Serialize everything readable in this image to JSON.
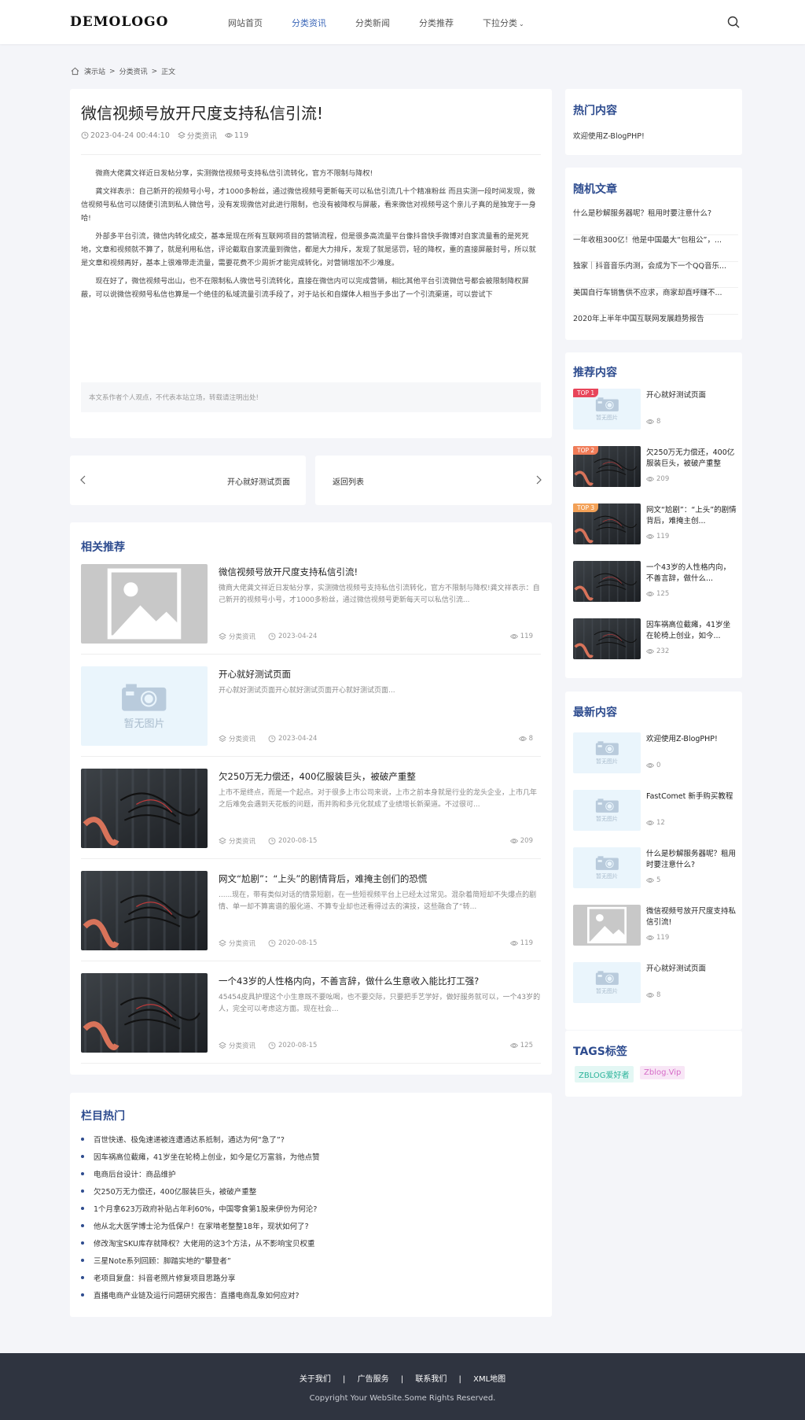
{
  "colors": {
    "accent": "#3a66b8",
    "section_title": "#2e4c8f",
    "footer_bg": "#2f3440",
    "top1": "#e8455a",
    "top2": "#f07c58",
    "top3": "#f3a157"
  },
  "header": {
    "logo": "DEMOLOGO",
    "nav": [
      {
        "label": "网站首页"
      },
      {
        "label": "分类资讯"
      },
      {
        "label": "分类新闻"
      },
      {
        "label": "分类推荐"
      },
      {
        "label": "下拉分类"
      }
    ]
  },
  "breadcrumb": {
    "items": [
      "演示站",
      ">",
      "分类资讯",
      ">",
      "正文"
    ]
  },
  "article": {
    "title": "微信视频号放开尺度支持私信引流!",
    "date": "2023-04-24 00:44:10",
    "category": "分类资讯",
    "views": "119",
    "paragraphs": [
      "微商大佬龚文祥近日发帖分享，实测微信视频号支持私信引流转化，官方不限制与降权!",
      "龚文祥表示：自己新开的视频号小号，才1000多粉丝，通过微信视频号更新每天可以私信引流几十个精准粉丝 而且实测一段时间发现，微信视频号私信可以随便引流到私人微信号，没有发现微信对此进行限制，也没有被降权与屏蔽，看来微信对视频号这个亲儿子真的是独宠于一身哈!",
      "外部多平台引流，微信内转化成交，基本是现在所有互联网项目的营销流程，但是很多高流量平台像抖音快手微博对自家流量看的是死死地，文章和视频就不算了，就是利用私信，评论截取自家流量到微信，都是大力排斥，发现了就是惩罚，轻的降权，重的直接屏蔽封号，所以就是文章和视频再好，基本上很难带走流量，需要花费不少周折才能完成转化，对营销增加不少难度。",
      "现在好了，微信视频号出山，也不在限制私人微信号引流转化，直接在微信内可以完成营销，相比其他平台引流微信号都会被限制降权屏蔽，可以说微信视频号私信也算是一个绝佳的私域流量引流手段了，对于站长和自媒体人相当于多出了一个引流渠道，可以尝试下"
    ],
    "note": "本文系作者个人观点，不代表本站立场，转载请注明出处!"
  },
  "prevnext": {
    "prev": "开心就好测试页面",
    "next": "返回列表"
  },
  "related": {
    "title": "相关推荐",
    "items": [
      {
        "title": "微信视频号放开尺度支持私信引流!",
        "desc": "微商大佬龚文祥近日发帖分享，实测微信视频号支持私信引流转化，官方不限制与降权!龚文祥表示：自己新开的视频号小号，才1000多粉丝，通过微信视频号更新每天可以私信引流...",
        "cat": "分类资讯",
        "date": "2023-04-24",
        "views": "119",
        "thumb": "image"
      },
      {
        "title": "开心就好测试页面",
        "desc": "开心就好测试页面开心就好测试页面开心就好测试页面...",
        "cat": "分类资讯",
        "date": "2023-04-24",
        "views": "8",
        "thumb": "noimage",
        "noimage": "暂无图片"
      },
      {
        "title": "欠250万无力偿还，400亿服装巨头，被破产重整",
        "desc": "上市不是终点，而是一个起点。对于很多上市公司来说，上市之前本身就是行业的龙头企业，上市几年之后难免会遇到天花板的问题，而并购和多元化就成了业绩增长新渠道。不过很可...",
        "cat": "分类资讯",
        "date": "2020-08-15",
        "views": "209",
        "thumb": "photo"
      },
      {
        "title": "网文“尬剧”：“上头”的剧情背后，难掩主创们的恐慌",
        "desc": "......现在，带有类似对话的情景短剧，在一些短视频平台上已经太过常见。混杂着简短却不失爆点的剧情、单一却不算离谱的服化道、不算专业却也还看得过去的演技，这些融合了“转...",
        "cat": "分类资讯",
        "date": "2020-08-15",
        "views": "119",
        "thumb": "photo"
      },
      {
        "title": "一个43岁的人性格内向，不善言辞，做什么生意收入能比打工强?",
        "desc": "45454皮具护理这个小生意既不要吆喝，也不要交际，只要把手艺学好，做好服务就可以，一个43岁的人，完全可以考虑这方面。现在社会...",
        "cat": "分类资讯",
        "date": "2020-08-15",
        "views": "125",
        "thumb": "photo"
      }
    ]
  },
  "hot_column": {
    "title": "栏目热门",
    "items": [
      "百世快递、极兔速递被连遭通达系抵制，通达为何“急了”?",
      "因车祸高位截瘫，41岁坐在轮椅上创业，如今是亿万富翁，为他点赞",
      "电商后台设计：商品维护",
      "欠250万无力偿还，400亿服装巨头，被破产重整",
      "1个月拿623万政府补贴占年利60%，中国零食第1股来伊份为何沦?",
      "他从北大医学博士沦为低保户！在家啃老整整18年，现状如何了?",
      "修改淘宝SKU库存就降权？大佬用的这3个方法，从不影响宝贝权重",
      "三星Note系列回顾：脚踏实地的“攀登者”",
      "老项目复盘：抖音老照片修复项目思路分享",
      "直播电商产业链及运行问题研究报告：直播电商乱象如何应对?"
    ]
  },
  "sidebar": {
    "hot": {
      "title": "热门内容",
      "item": "欢迎使用Z-BlogPHP!"
    },
    "random": {
      "title": "随机文章",
      "items": [
        "什么是秒解服务器呢？租用时要注意什么?",
        "一年收租300亿！他是中国最大“包租公”，...",
        "独家｜抖音音乐内测，会成为下一个QQ音乐...",
        "美国自行车销售供不应求，商家却直呼赚不...",
        "2020年上半年中国互联网发展趋势报告"
      ]
    },
    "recommend": {
      "title": "推荐内容",
      "items": [
        {
          "badge": "TOP 1",
          "title": "开心就好测试页面",
          "views": "8",
          "thumb": "noimage",
          "noimage": "暂无图片"
        },
        {
          "badge": "TOP 2",
          "title": "欠250万无力偿还，400亿服装巨头，被破产重整",
          "views": "209",
          "thumb": "photo"
        },
        {
          "badge": "TOP 3",
          "title": "网文“尬剧”：“上头”的剧情背后，难掩主创...",
          "views": "119",
          "thumb": "photo"
        },
        {
          "badge": "",
          "title": "一个43岁的人性格内向，不善言辞，做什么...",
          "views": "125",
          "thumb": "photo"
        },
        {
          "badge": "",
          "title": "因车祸高位截瘫，41岁坐在轮椅上创业，如今...",
          "views": "232",
          "thumb": "photo"
        }
      ]
    },
    "latest": {
      "title": "最新内容",
      "items": [
        {
          "title": "欢迎使用Z-BlogPHP!",
          "views": "0",
          "thumb": "noimage",
          "noimage": "暂无图片"
        },
        {
          "title": "FastComet 新手购买教程",
          "views": "12",
          "thumb": "noimage",
          "noimage": "暂无图片"
        },
        {
          "title": "什么是秒解服务器呢？租用时要注意什么?",
          "views": "5",
          "thumb": "noimage",
          "noimage": "暂无图片"
        },
        {
          "title": "微信视频号放开尺度支持私信引流!",
          "views": "119",
          "thumb": "image"
        },
        {
          "title": "开心就好测试页面",
          "views": "8",
          "thumb": "noimage",
          "noimage": "暂无图片"
        }
      ]
    },
    "tags": {
      "title": "TAGS标签",
      "items": [
        "ZBLOG爱好者",
        "Zblog.Vip"
      ]
    }
  },
  "footer": {
    "links": [
      "关于我们",
      "|",
      "广告服务",
      "|",
      "联系我们",
      "|",
      "XML地图"
    ],
    "copyright": "Copyright Your WebSite.Some Rights Reserved."
  }
}
